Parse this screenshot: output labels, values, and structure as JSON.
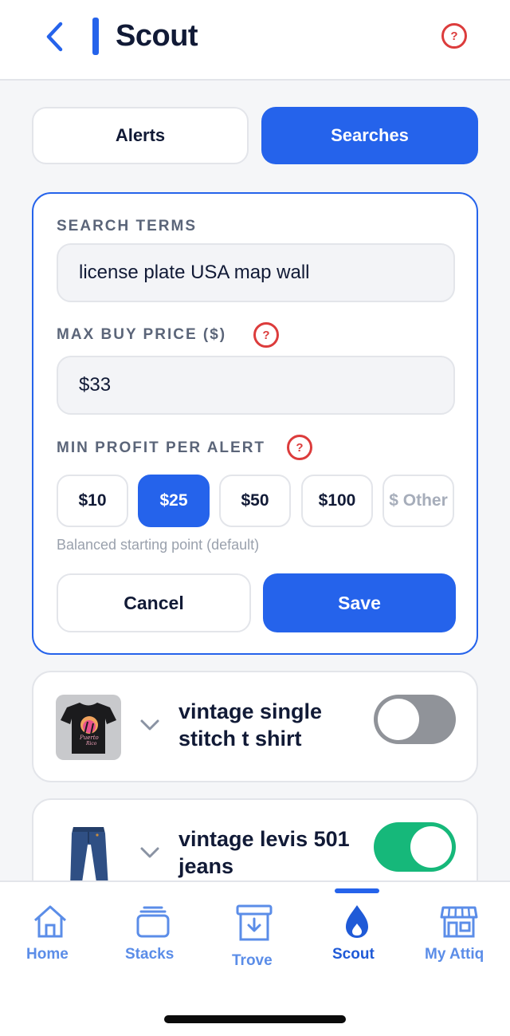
{
  "header": {
    "title": "Scout"
  },
  "segments": {
    "alerts": "Alerts",
    "searches": "Searches",
    "active": "Searches"
  },
  "form": {
    "search_terms_label": "SEARCH TERMS",
    "search_terms_value": "license plate USA map wall",
    "max_buy_label": "MAX BUY PRICE ($)",
    "max_buy_value": "$33",
    "min_profit_label": "MIN PROFIT PER ALERT",
    "profit_options": [
      "$10",
      "$25",
      "$50",
      "$100",
      "$ Other"
    ],
    "selected_profit": "$25",
    "hint": "Balanced starting point (default)",
    "cancel_label": "Cancel",
    "save_label": "Save"
  },
  "help_glyph": "?",
  "searches": [
    {
      "title": "vintage single stitch t shirt",
      "enabled": false,
      "thumb": "t-shirt-image"
    },
    {
      "title": "vintage levis 501 jeans",
      "enabled": true,
      "thumb": "jeans-image"
    }
  ],
  "tabbar": {
    "items": [
      {
        "label": "Home",
        "icon": "home-icon"
      },
      {
        "label": "Stacks",
        "icon": "stacks-icon"
      },
      {
        "label": "Trove",
        "icon": "trove-icon"
      },
      {
        "label": "Scout",
        "icon": "flame-icon"
      },
      {
        "label": "My Attiq",
        "icon": "store-icon"
      }
    ],
    "active": "Scout"
  },
  "colors": {
    "accent": "#2563eb",
    "danger": "#dc3c3c",
    "toggle_on": "#16b87a",
    "toggle_off": "#909399"
  }
}
